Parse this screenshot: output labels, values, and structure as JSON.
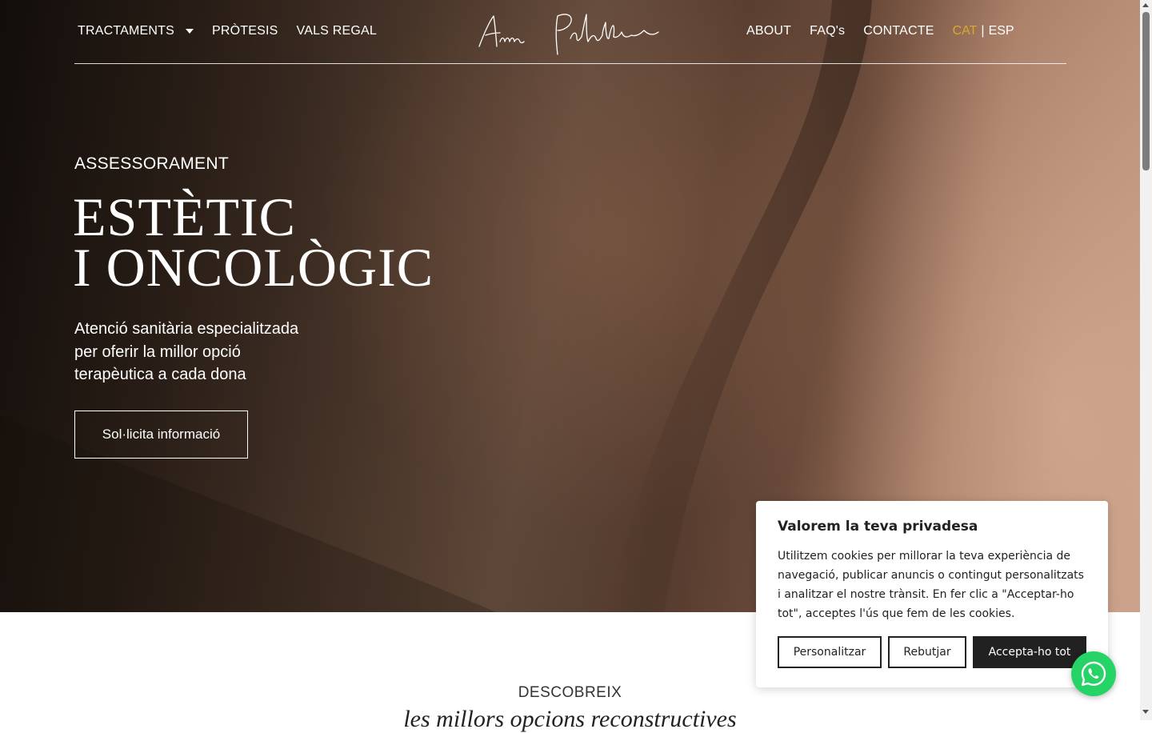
{
  "nav": {
    "left": [
      {
        "label": "TRACTAMENTS",
        "has_dropdown": true
      },
      {
        "label": "PRÒTESIS"
      },
      {
        "label": "VALS REGAL"
      }
    ],
    "right": [
      {
        "label": "ABOUT"
      },
      {
        "label": "FAQ's"
      },
      {
        "label": "CONTACTE"
      }
    ],
    "lang": {
      "active": "CAT",
      "separator": "|",
      "other": "ESP",
      "active_color": "#d8a82e"
    },
    "logo_text": "Anna Padulles"
  },
  "hero": {
    "eyebrow": "ASSESSORAMENT",
    "title_line1": "ESTÈTIC",
    "title_line2": "I ONCOLÒGIC",
    "lead_line1": "Atenció sanitària especialitzada",
    "lead_line2": "per oferir la millor opció",
    "lead_line3": "terapèutica a cada dona",
    "cta": "Sol·licita informació"
  },
  "section": {
    "eyebrow": "DESCOBREIX",
    "title": "les millors opcions reconstructives"
  },
  "cookie": {
    "title": "Valorem la teva privadesa",
    "text": "Utilitzem cookies per millorar la teva experiència de navegació, publicar anuncis o contingut personalitzats i analitzar el nostre trànsit. En fer clic a \"Acceptar-ho tot\", acceptes l'ús que fem de les cookies.",
    "customize": "Personalitzar",
    "reject": "Rebutjar",
    "accept": "Accepta-ho tot"
  },
  "icons": {
    "dropdown": "caret-down-icon",
    "chat": "whatsapp-icon"
  },
  "colors": {
    "accent": "#d8a82e",
    "whatsapp": "#25d366",
    "dark_button": "#212121"
  }
}
